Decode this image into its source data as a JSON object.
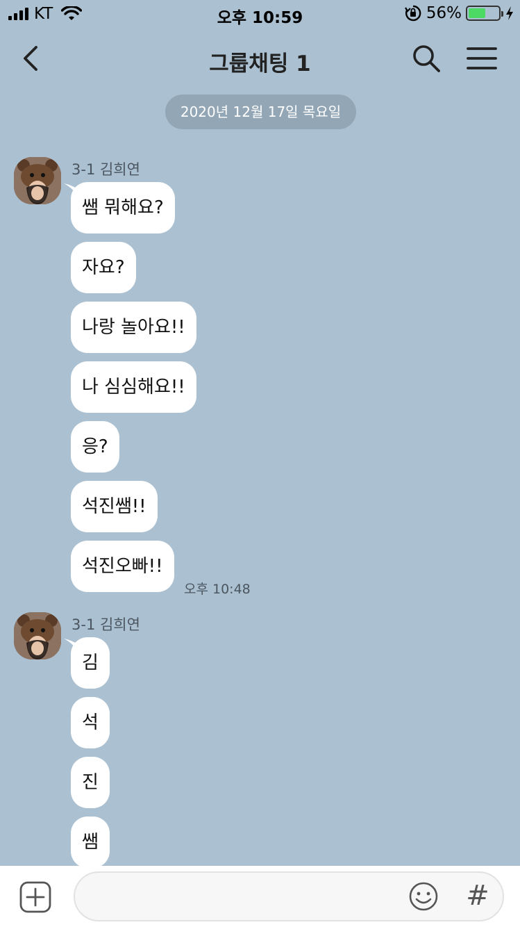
{
  "status_bar": {
    "carrier": "KT",
    "time": "오후 10:59",
    "battery_percent": "56%",
    "battery_level": 0.56
  },
  "header": {
    "title": "그룹채팅 1",
    "back_icon": "chevron-left-icon",
    "search_icon": "search-icon",
    "menu_icon": "hamburger-menu-icon"
  },
  "date_divider": "2020년 12월 17일 목요일",
  "groups": [
    {
      "sender": "3-1 김희연",
      "messages": [
        "쌤 뭐해요?",
        "자요?",
        "나랑 놀아요!!",
        "나 심심해요!!",
        "응?",
        "석진쌤!!",
        "석진오빠!!"
      ],
      "time": "오후 10:48"
    },
    {
      "sender": "3-1 김희연",
      "messages": [
        "김",
        "석",
        "진",
        "쌤"
      ]
    }
  ],
  "input_bar": {
    "placeholder": "",
    "plus_icon": "plus-square-icon",
    "emoji_icon": "smiley-icon",
    "hash_label": "#"
  },
  "colors": {
    "background": "#abc1d1",
    "bubble": "#ffffff",
    "battery": "#4cd964"
  }
}
